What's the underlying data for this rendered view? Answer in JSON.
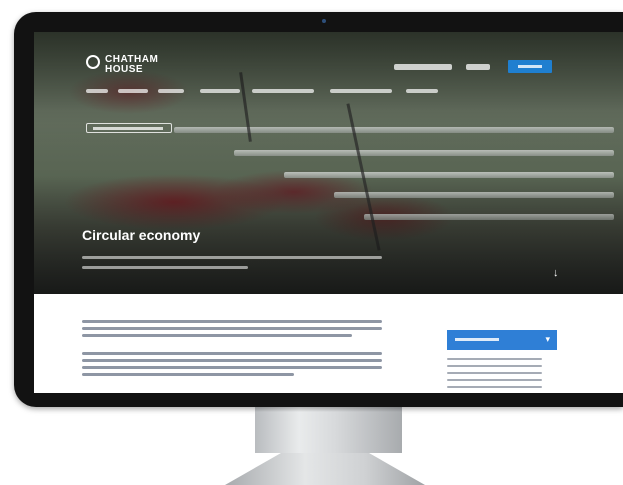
{
  "site": {
    "logo": {
      "line1": "CHATHAM",
      "line2": "HOUSE"
    }
  },
  "hero": {
    "title": "Circular economy"
  },
  "colors": {
    "cta_blue": "#2f7fd6",
    "monitor_bezel": "#121212"
  },
  "icons": {
    "logo": "chatham-house-logo-icon",
    "scroll": "scroll-down-arrow-icon",
    "dropdown": "chevron-down-icon"
  },
  "glyphs": {
    "scroll_arrow": "↓",
    "chevron": "▾"
  }
}
